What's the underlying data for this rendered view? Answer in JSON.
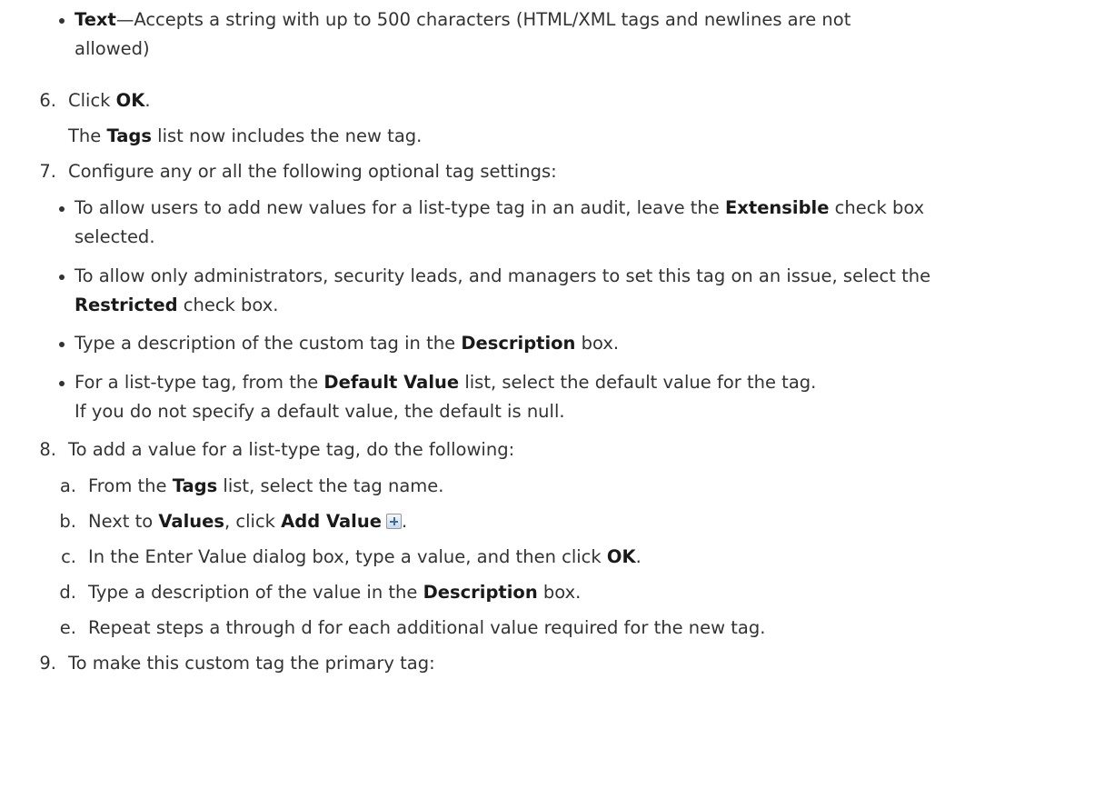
{
  "doc": {
    "text_bullet_term": "Text",
    "text_bullet_desc_1": "—Accepts a string with up to 500 characters (HTML/XML tags and newlines are not",
    "text_bullet_desc_2": "allowed)",
    "s6_num": "6.",
    "s6_pre": "Click ",
    "s6_bold": "OK",
    "s6_post": ".",
    "s6_sub_pre": "The ",
    "s6_sub_bold": "Tags",
    "s6_sub_post": " list now includes the new tag.",
    "s7_num": "7.",
    "s7_text": "Configure any or all the following optional tag settings:",
    "s7_b1_pre": "To allow users to add new values for a list-type tag in an audit, leave the ",
    "s7_b1_bold": "Extensible",
    "s7_b1_post": " check box",
    "s7_b1_line2": "selected.",
    "s7_b2_line1": "To allow only administrators, security leads, and managers to set this tag on an issue, select the",
    "s7_b2_bold": "Restricted",
    "s7_b2_post": " check box.",
    "s7_b3_pre": "Type a description of the custom tag in the ",
    "s7_b3_bold": "Description",
    "s7_b3_post": " box.",
    "s7_b4_pre": "For a list-type tag, from the ",
    "s7_b4_bold": "Default Value",
    "s7_b4_post": " list, select the default value for the tag.",
    "s7_b4_note": "If you do not specify a default value, the default is null.",
    "s8_num": "8.",
    "s8_text": "To add a value for a list-type tag, do the following:",
    "s8a_letter": "a.",
    "s8a_pre": "From the ",
    "s8a_bold": "Tags",
    "s8a_post": " list, select the tag name.",
    "s8b_letter": "b.",
    "s8b_pre": "Next to ",
    "s8b_bold1": "Values",
    "s8b_mid": ", click ",
    "s8b_bold2": "Add Value",
    "s8b_post": ".",
    "s8b_icon": "add-value-icon",
    "s8c_letter": "c.",
    "s8c_pre": "In the Enter Value dialog box, type a value, and then click ",
    "s8c_bold": "OK",
    "s8c_post": ".",
    "s8d_letter": "d.",
    "s8d_pre": "Type a description of the value in the ",
    "s8d_bold": "Description",
    "s8d_post": " box.",
    "s8e_letter": "e.",
    "s8e_text": "Repeat steps a through d for each additional value required for the new tag.",
    "s9_num": "9.",
    "s9_text": "To make this custom tag the primary tag:"
  }
}
